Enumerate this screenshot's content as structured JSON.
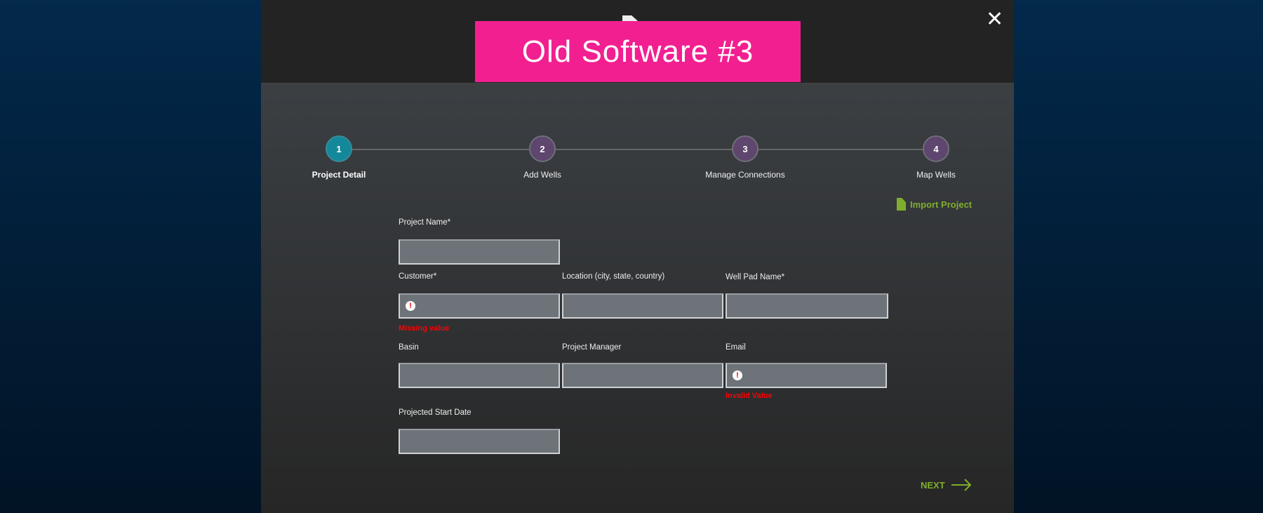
{
  "banner": {
    "title": "Old Software #3"
  },
  "steps": [
    {
      "number": "1",
      "label": "Project Detail",
      "active": true
    },
    {
      "number": "2",
      "label": "Add Wells"
    },
    {
      "number": "3",
      "label": "Manage Connections"
    },
    {
      "number": "4",
      "label": "Map Wells"
    }
  ],
  "import_label": "Import Project",
  "fields": {
    "project_name": {
      "label": "Project Name*",
      "value": ""
    },
    "customer": {
      "label": "Customer*",
      "value": "",
      "error": "Missing value"
    },
    "location": {
      "label": "Location (city, state, country)",
      "value": ""
    },
    "well_pad": {
      "label": "Well Pad Name*",
      "value": ""
    },
    "basin": {
      "label": "Basin",
      "value": ""
    },
    "manager": {
      "label": "Project Manager",
      "value": ""
    },
    "email": {
      "label": "Email",
      "value": "",
      "error": "Invalid Value"
    },
    "start_date": {
      "label": "Projected Start Date",
      "value": ""
    }
  },
  "next_label": "NEXT",
  "colors": {
    "accent": "#7fae2c",
    "error": "#ff0000",
    "active_step": "#13889b",
    "step": "#5e466e",
    "banner": "#f21f91"
  }
}
